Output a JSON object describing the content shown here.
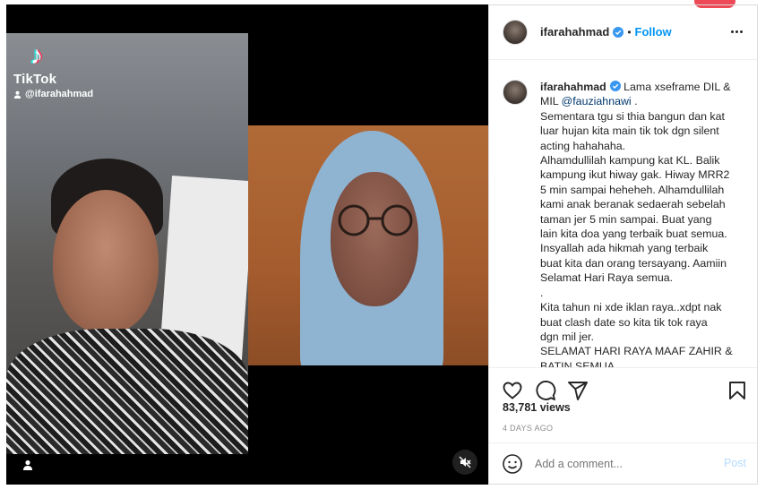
{
  "media": {
    "tiktok_brand": "TikTok",
    "tiktok_user": "@ifarahahmad"
  },
  "post": {
    "username": "ifarahahmad",
    "follow_label": "Follow",
    "separator": "•",
    "caption_username": "ifarahahmad",
    "caption_lines": [
      "Lama xseframe DIL &",
      "MIL"
    ],
    "mention": "@fauziahnawi",
    "caption_after_mention": " .",
    "caption_rest": [
      "Sementara tgu si thia bangun dan kat",
      "luar hujan kita main tik tok dgn silent",
      "acting hahahaha.",
      "Alhamdullilah kampung kat KL. Balik",
      "kampung ikut hiway gak. Hiway MRR2",
      "5 min sampai heheheh. Alhamdullilah",
      "kami anak beranak sedaerah sebelah",
      "taman jer 5 min sampai. Buat yang",
      "lain kita doa yang terbaik buat semua.",
      "Insyallah ada hikmah yang terbaik",
      "buat kita dan orang tersayang. Aamiin",
      "Selamat Hari Raya semua.",
      ".",
      "Kita tahun ni xde iklan raya..xdpt nak",
      "buat clash date so kita tik tok raya",
      "dgn mil jer.",
      "SELAMAT HARI RAYA MAAF ZAHIR &",
      "BATIN SEMUA"
    ],
    "views": "83,781 views",
    "time_ago": "4 DAYS AGO",
    "comment_placeholder": "Add a comment...",
    "post_label": "Post"
  },
  "colors": {
    "accent_blue": "#0095f6",
    "post_disabled": "#b3dbff",
    "notification_red": "#ed4956"
  },
  "icons": [
    "tiktok-icon",
    "person-icon",
    "mute-icon",
    "verified-badge-icon",
    "more-icon",
    "heart-icon",
    "comment-icon",
    "share-icon",
    "bookmark-icon",
    "emoji-icon"
  ]
}
